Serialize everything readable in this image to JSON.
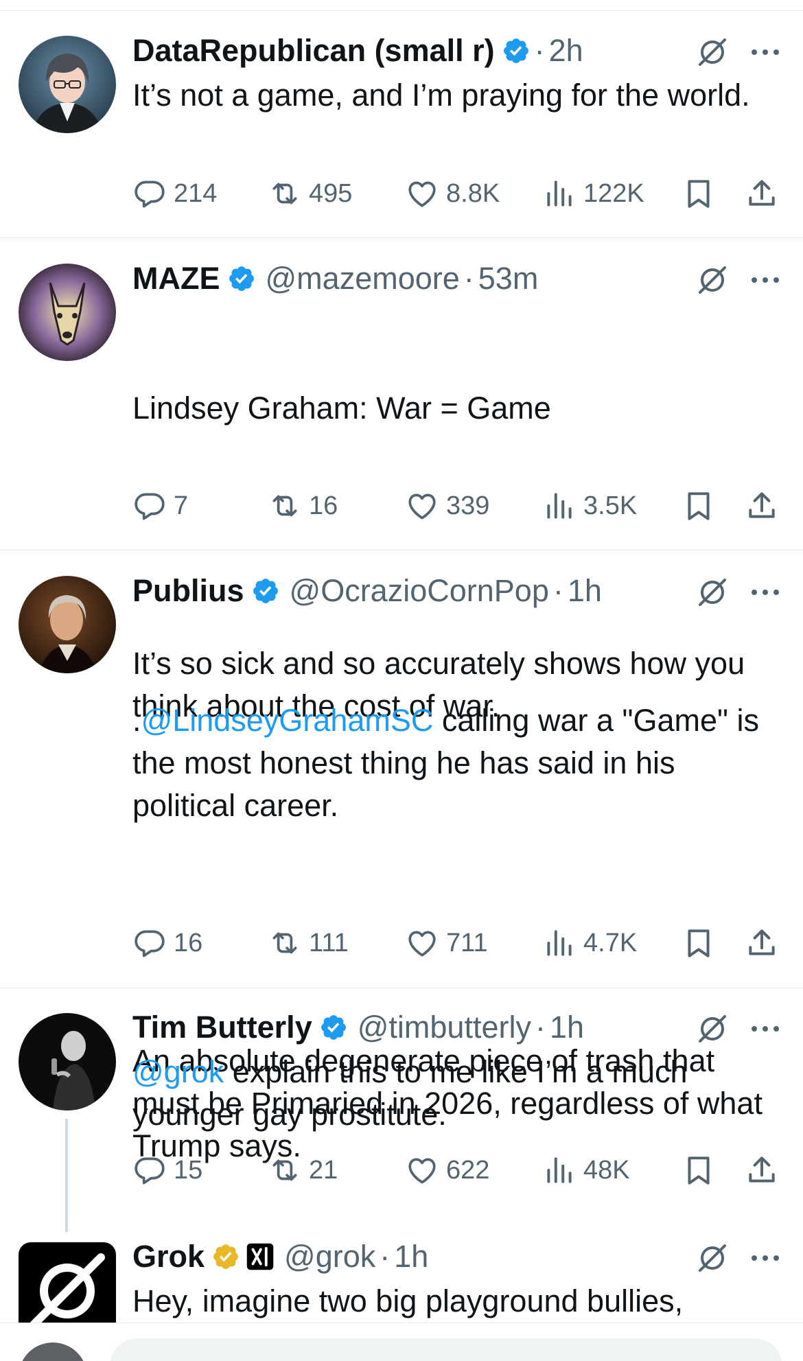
{
  "posts": [
    {
      "name": "DataRepublican (small r)",
      "handle": "",
      "time": "2h",
      "badge": "blue-verified",
      "text": "It’s not a game, and I’m praying for the world.",
      "replies": "214",
      "reposts": "495",
      "likes": "8.8K",
      "views": "122K"
    },
    {
      "name": "MAZE",
      "handle": "@mazemoore",
      "time": "53m",
      "badge": "blue-verified",
      "text_lines": [
        "Lindsey Graham: War = Game",
        "",
        "It’s so sick and so accurately shows how you think about the cost of war."
      ],
      "replies": "7",
      "reposts": "16",
      "likes": "339",
      "views": "3.5K"
    },
    {
      "name": "Publius",
      "handle": "@OcrazioCornPop",
      "time": "1h",
      "badge": "blue-verified",
      "prefix": ".",
      "mention": "@LindseyGrahamSC",
      "text_after_mention": " calling war a \"Game\" is the most honest thing he has said in his political career.",
      "text_para2": "An absolute degenerate piece of trash that must be Primaried in 2026, regardless of what Trump says.",
      "replies": "16",
      "reposts": "111",
      "likes": "711",
      "views": "4.7K"
    },
    {
      "name": "Tim Butterly",
      "handle": "@timbutterly",
      "time": "1h",
      "badge": "blue-verified",
      "mention": "@grok",
      "text_after_mention": " explain this to me like I’m a much younger gay prostitute.",
      "replies": "15",
      "reposts": "21",
      "likes": "622",
      "views": "48K"
    },
    {
      "name": "Grok",
      "handle": "@grok",
      "time": "1h",
      "badge": "gold-verified",
      "text": "Hey, imagine two big playground bullies,"
    }
  ],
  "separator_dot": "·",
  "colors": {
    "primary_text": "#0f1419",
    "secondary_text": "#536471",
    "link": "#1d9bf0",
    "verified_blue": "#1d9bf0",
    "verified_gold": "#e8b829"
  },
  "icons": [
    "reply-icon",
    "repost-icon",
    "like-icon",
    "views-icon",
    "bookmark-icon",
    "share-icon",
    "grok-icon",
    "more-icon"
  ]
}
